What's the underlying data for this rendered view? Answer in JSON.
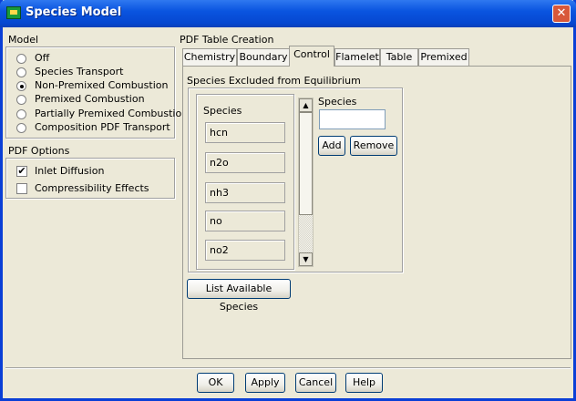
{
  "window": {
    "title": "Species Model"
  },
  "model": {
    "label": "Model",
    "options": [
      {
        "label": "Off",
        "selected": false
      },
      {
        "label": "Species Transport",
        "selected": false
      },
      {
        "label": "Non-Premixed Combustion",
        "selected": true
      },
      {
        "label": "Premixed Combustion",
        "selected": false
      },
      {
        "label": "Partially Premixed Combustion",
        "selected": false
      },
      {
        "label": "Composition PDF Transport",
        "selected": false
      }
    ]
  },
  "pdf_options": {
    "label": "PDF Options",
    "items": [
      {
        "label": "Inlet Diffusion",
        "checked": true
      },
      {
        "label": "Compressibility Effects",
        "checked": false
      }
    ]
  },
  "pdf_table": {
    "label": "PDF Table Creation",
    "tabs": [
      "Chemistry",
      "Boundary",
      "Control",
      "Flamelet",
      "Table",
      "Premixed"
    ],
    "active_tab": "Control"
  },
  "control": {
    "excluded_label": "Species Excluded from Equilibrium",
    "species_list_label": "Species",
    "species": [
      "hcn",
      "n2o",
      "nh3",
      "no",
      "no2"
    ],
    "species_input_label": "Species",
    "species_input_value": "",
    "add_label": "Add",
    "remove_label": "Remove",
    "list_available_label": "List Available Species"
  },
  "footer": {
    "ok": "OK",
    "apply": "Apply",
    "cancel": "Cancel",
    "help": "Help"
  },
  "colors": {
    "titlebar": "#0a55e0",
    "dialog_bg": "#ece9d8",
    "close_button": "#d8583a"
  },
  "icons": [
    "app-icon",
    "close-icon",
    "scroll-up-arrow-icon",
    "scroll-down-arrow-icon",
    "checkmark-icon"
  ]
}
